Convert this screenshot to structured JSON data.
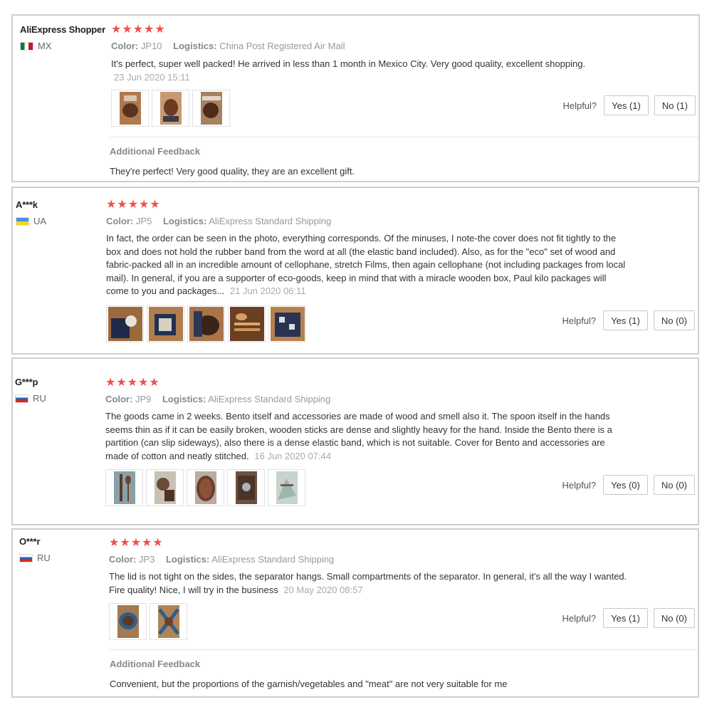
{
  "helpful_label": "Helpful?",
  "additional_feedback_title": "Additional Feedback",
  "color_label": "Color:",
  "logistics_label": "Logistics:",
  "star_count": 5,
  "star_color": "#f04f4f",
  "reviews": [
    {
      "user": "AliExpress Shopper",
      "country": "MX",
      "color": "JP10",
      "logistics": "China Post Registered Air Mail",
      "text": "It's perfect, super well packed! He arrived in less than 1 month in Mexico City. Very good quality, excellent shopping.",
      "date": "23 Jun 2020 15:11",
      "yes": "Yes (1)",
      "no": "No (1)",
      "additional_feedback": "They're perfect! Very good quality, they are an excellent gift."
    },
    {
      "user": "A***k",
      "country": "UA",
      "color": "JP5",
      "logistics": "AliExpress Standard Shipping",
      "text": "In fact, the order can be seen in the photo, everything corresponds. Of the minuses, I note-the cover does not fit tightly to the box and does not hold the rubber band from the word at all (the elastic band included). Also, as for the \"eco\" set of wood and fabric-packed all in an incredible amount of cellophane, stretch Films, then again cellophane (not including packages from local mail). In general, if you are a supporter of eco-goods, keep in mind that with a miracle wooden box, Paul kilo packages will come to you and packages...",
      "date": "21 Jun 2020 06:11",
      "yes": "Yes (1)",
      "no": "No (0)"
    },
    {
      "user": "G***p",
      "country": "RU",
      "color": "JP9",
      "logistics": "AliExpress Standard Shipping",
      "text": "The goods came in 2 weeks. Bento itself and accessories are made of wood and smell also it. The spoon itself in the hands seems thin as if it can be easily broken, wooden sticks are dense and slightly heavy for the hand. Inside the Bento there is a partition (can slip sideways), also there is a dense elastic band, which is not suitable. Cover for Bento and accessories are made of cotton and neatly stitched.",
      "date": "16 Jun 2020 07:44",
      "yes": "Yes (0)",
      "no": "No (0)"
    },
    {
      "user": "O***r",
      "country": "RU",
      "color": "JP3",
      "logistics": "AliExpress Standard Shipping",
      "text": "The lid is not tight on the sides, the separator hangs. Small compartments of the separator. In general, it's all the way I wanted. Fire quality! Nice, I will try in the business",
      "date": "20 May 2020 08:57",
      "yes": "Yes (1)",
      "no": "No (0)",
      "additional_feedback": "Convenient, but the proportions of the garnish/vegetables and \"meat\" are not very suitable for me"
    }
  ]
}
